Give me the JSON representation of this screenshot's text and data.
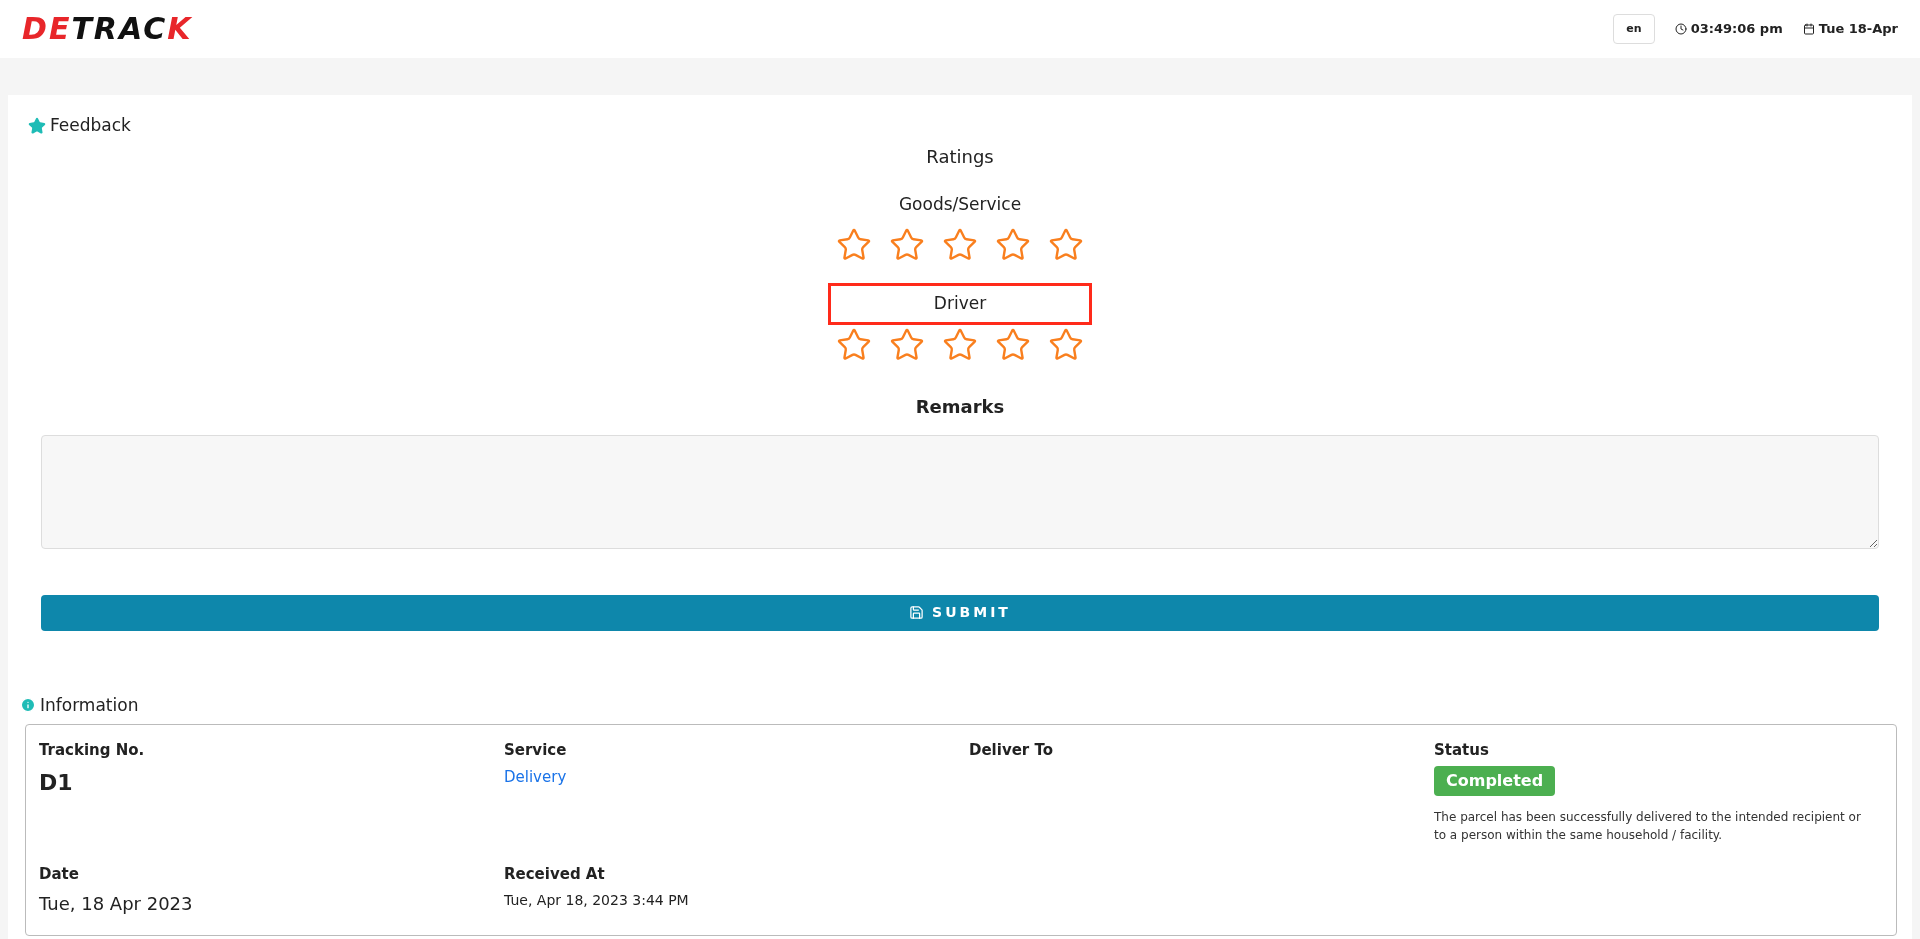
{
  "header": {
    "logo": [
      {
        "text": "DE",
        "color": "#e8262a"
      },
      {
        "text": "TRAC",
        "color": "#111111"
      },
      {
        "text": "K",
        "color": "#e8262a"
      }
    ],
    "language": "en",
    "time": "03:49:06 pm",
    "date": "Tue 18-Apr"
  },
  "feedback": {
    "title": "Feedback",
    "ratings_title": "Ratings",
    "ratings": [
      {
        "label": "Goods/Service",
        "stars": 0,
        "highlighted": false
      },
      {
        "label": "Driver",
        "stars": 0,
        "highlighted": true
      }
    ],
    "remarks_label": "Remarks",
    "submit": "SUBMIT"
  },
  "information": {
    "title": "Information",
    "fields": [
      {
        "label": "Tracking No.",
        "value": "D1",
        "kind": "large"
      },
      {
        "label": "Service",
        "value": "Delivery",
        "kind": "link"
      },
      {
        "label": "Deliver To",
        "kind": "empty"
      },
      {
        "label": "Status",
        "value": "Completed",
        "kind": "badge",
        "description": "The parcel has been successfully delivered to the intended recipient or to a person within the same household / facility."
      },
      {
        "label": "Date",
        "value": "Tue, 18 Apr 2023",
        "kind": "medium"
      },
      {
        "label": "Received At",
        "value": "Tue, Apr 18, 2023 3:44 PM",
        "kind": "small"
      }
    ]
  }
}
